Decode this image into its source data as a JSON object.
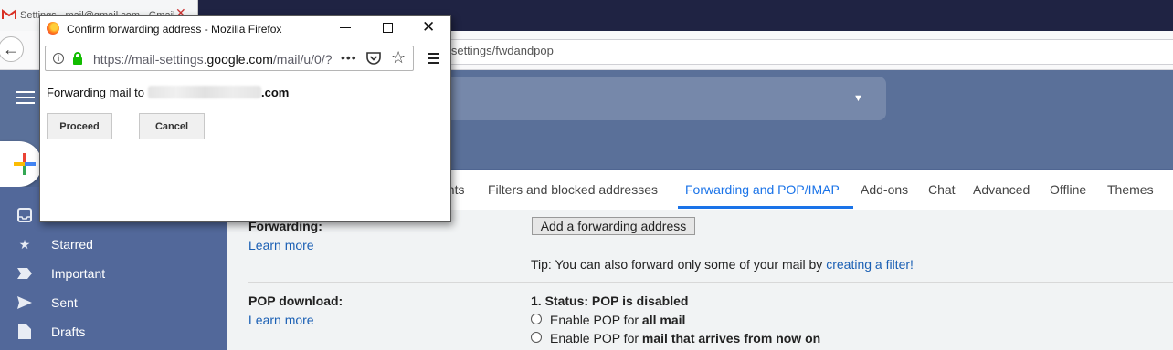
{
  "background_tab": {
    "title": "Settings - mail@gmail.com - Gmail"
  },
  "background_url": "/#settings/fwdandpop",
  "sidebar": {
    "items": [
      {
        "label": "",
        "icon": "inbox-icon"
      },
      {
        "label": "Starred",
        "icon": "star-icon"
      },
      {
        "label": "Important",
        "icon": "important-icon"
      },
      {
        "label": "Sent",
        "icon": "send-icon"
      },
      {
        "label": "Drafts",
        "icon": "draft-icon"
      }
    ]
  },
  "settings_tabs": {
    "accounts_partial": "unts",
    "filters": "Filters and blocked addresses",
    "forwarding": "Forwarding and POP/IMAP",
    "addons": "Add-ons",
    "chat": "Chat",
    "advanced": "Advanced",
    "offline": "Offline",
    "themes": "Themes"
  },
  "forwarding": {
    "label": "Forwarding:",
    "learn_more": "Learn more",
    "add_button": "Add a forwarding address",
    "tip_text": "Tip: You can also forward only some of your mail by",
    "tip_link": "creating a filter!"
  },
  "pop": {
    "label": "POP download:",
    "learn_more": "Learn more",
    "status": "1. Status: POP is disabled",
    "option_prefix": "Enable POP for",
    "option1_bold": "all mail",
    "option2_bold": "mail that arrives from now on"
  },
  "popup": {
    "title": "Confirm forwarding address - Mozilla Firefox",
    "url_prefix": "https://mail-settings.",
    "url_domain": "google.com",
    "url_suffix": "/mail/u/0/?",
    "message_prefix": "Forwarding mail to",
    "message_domain": ".com",
    "proceed": "Proceed",
    "cancel": "Cancel"
  },
  "colors": {
    "gmail_sidebar": "#52689a",
    "accent_blue": "#1a73e8",
    "link_blue": "#1a5fb4"
  }
}
